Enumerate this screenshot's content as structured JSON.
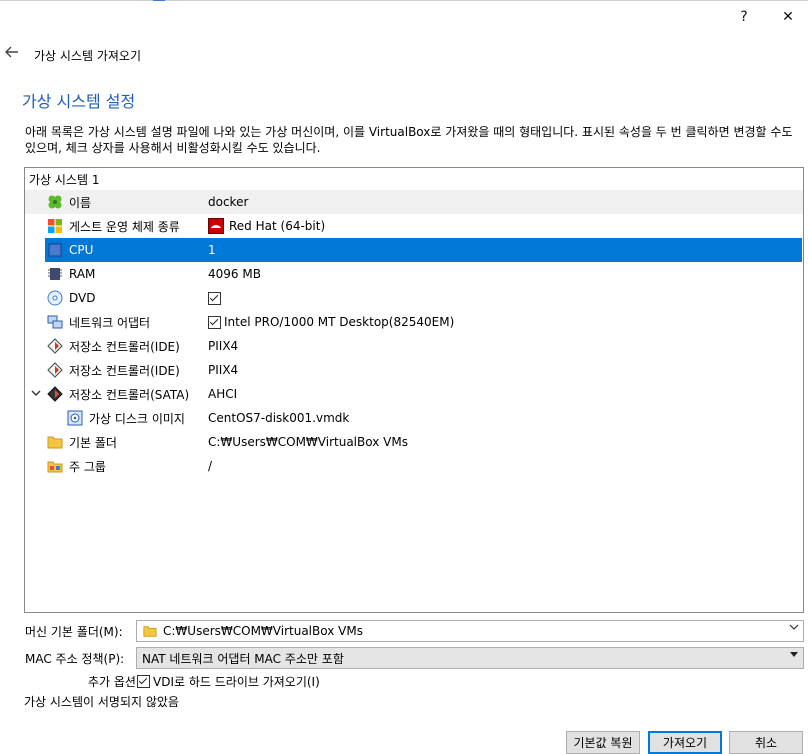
{
  "window": {
    "help_glyph": "?",
    "close_glyph": "✕"
  },
  "wizard": {
    "title": "가상 시스템 가져오기"
  },
  "page": {
    "title": "가상 시스템 설정",
    "description": "아래 목록은 가상 시스템 설명 파일에 나와 있는 가상 머신이며, 이를 VirtualBox로 가져왔을 때의 형태입니다. 표시된 속성을 두 번 클릭하면 변경할 수도 있으며, 체크 상자를 사용해서 비활성화시킬 수도 있습니다."
  },
  "tree": {
    "group_label": "가상 시스템 1",
    "rows": [
      {
        "name": "이름",
        "value": "docker",
        "icon": "name-clover-icon"
      },
      {
        "name": "게스트 운영 체제 종류",
        "value": "Red Hat (64-bit)",
        "icon": "os-windows-icon"
      },
      {
        "name": "CPU",
        "value": "1",
        "icon": "cpu-chip-icon",
        "selected": true
      },
      {
        "name": "RAM",
        "value": "4096 MB",
        "icon": "ram-chip-icon"
      },
      {
        "name": "DVD",
        "value": "",
        "icon": "dvd-disc-icon"
      },
      {
        "name": "네트워크 어댑터",
        "value": "Intel PRO/1000 MT Desktop(82540EM)",
        "icon": "network-adapter-icon"
      },
      {
        "name": "저장소 컨트롤러(IDE)",
        "value": "PIIX4",
        "icon": "ide-controller-icon"
      },
      {
        "name": "저장소 컨트롤러(IDE)",
        "value": "PIIX4",
        "icon": "ide-controller-icon"
      },
      {
        "name": "저장소 컨트롤러(SATA)",
        "value": "AHCI",
        "icon": "sata-controller-icon"
      },
      {
        "name": "가상 디스크 이미지",
        "value": "CentOS7-disk001.vmdk",
        "icon": "disk-image-icon"
      },
      {
        "name": "기본 폴더",
        "value": "C:₩Users₩COM₩VirtualBox VMs",
        "icon": "folder-icon"
      },
      {
        "name": "주 그룹",
        "value": "/",
        "icon": "group-icon"
      }
    ]
  },
  "machine_folder": {
    "label": "머신 기본 폴더(M):",
    "value": "C:₩Users₩COM₩VirtualBox VMs"
  },
  "mac_policy": {
    "label": "MAC 주소 정책(P):",
    "value": "NAT 네트워크 어댑터 MAC 주소만 포함"
  },
  "extra_options": {
    "label": "추가 옵션:",
    "checkbox_label": "VDI로 하드 드라이브 가져오기(I)"
  },
  "status": {
    "text": "가상 시스템이 서명되지 않았음"
  },
  "buttons": {
    "restore_defaults": "기본값 복원",
    "import": "가져오기",
    "cancel": "취소"
  },
  "colors": {
    "accent": "#0078d7",
    "title_blue": "#1f5eb8"
  }
}
